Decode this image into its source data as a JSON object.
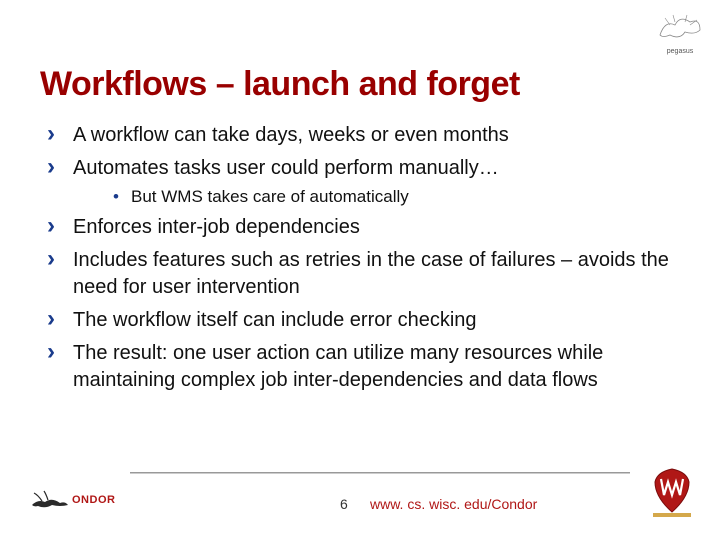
{
  "title": "Workflows – launch and forget",
  "bullets": [
    {
      "text": "A workflow can take days, weeks or even months"
    },
    {
      "text": "Automates tasks user could perform manually…",
      "sub": [
        {
          "text": "But WMS takes care of automatically"
        }
      ]
    },
    {
      "text": "Enforces inter-job dependencies"
    },
    {
      "text": "Includes features such as retries in the case of failures – avoids the need for user intervention"
    },
    {
      "text": "The workflow itself can include error checking"
    },
    {
      "text": "The result: one user action can utilize many resources while maintaining complex job inter-dependencies and data flows"
    }
  ],
  "footer": {
    "slide_number": "6",
    "url": "www. cs. wisc. edu/Condor",
    "condor_label": "ONDOR"
  },
  "logos": {
    "pegasus_label": "pegasus"
  }
}
